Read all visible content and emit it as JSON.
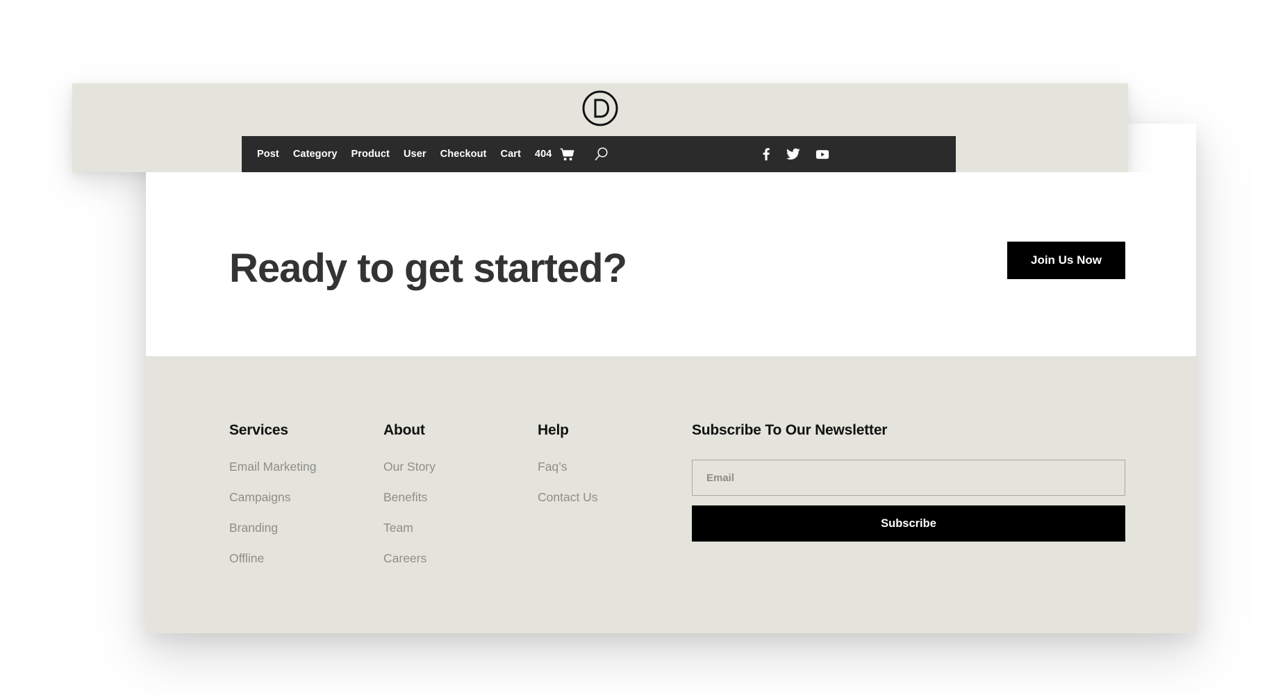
{
  "logo": {
    "letter": "D",
    "name": "divi-logo"
  },
  "nav": {
    "links": [
      {
        "label": "Post"
      },
      {
        "label": "Category"
      },
      {
        "label": "Product"
      },
      {
        "label": "User"
      },
      {
        "label": "Checkout"
      },
      {
        "label": "Cart"
      },
      {
        "label": "404"
      }
    ],
    "icons": [
      {
        "name": "cart-icon"
      },
      {
        "name": "search-icon"
      }
    ],
    "social": [
      {
        "name": "facebook-icon"
      },
      {
        "name": "twitter-icon"
      },
      {
        "name": "youtube-icon"
      }
    ]
  },
  "cta": {
    "heading": "Ready to get started?",
    "button_label": "Join Us Now"
  },
  "footer": {
    "columns": [
      {
        "title": "Services",
        "links": [
          "Email Marketing",
          "Campaigns",
          "Branding",
          "Offline"
        ]
      },
      {
        "title": "About",
        "links": [
          "Our Story",
          "Benefits",
          "Team",
          "Careers"
        ]
      },
      {
        "title": "Help",
        "links": [
          "Faq’s",
          "Contact Us"
        ]
      }
    ],
    "newsletter": {
      "title": "Subscribe To Our Newsletter",
      "email_placeholder": "Email",
      "email_value": "",
      "button_label": "Subscribe"
    }
  },
  "colors": {
    "beige": "#e4e4dc",
    "nav_dark": "#2b2b2b",
    "button_black": "#000000",
    "heading": "#333333",
    "link_gray": "#8e8e88",
    "page_white": "#ffffff"
  }
}
